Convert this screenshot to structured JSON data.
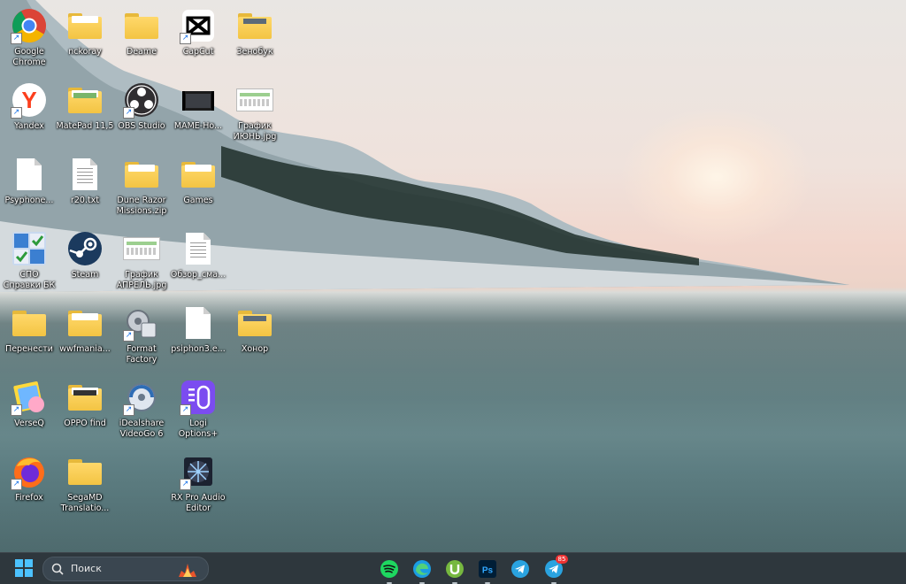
{
  "desktop": {
    "icons": [
      {
        "label": "Google Chrome",
        "icon": "chrome-icon"
      },
      {
        "label": "nckoray",
        "icon": "folder-icon"
      },
      {
        "label": "Deame",
        "icon": "folder-icon"
      },
      {
        "label": "CapCut",
        "icon": "capcut-icon"
      },
      {
        "label": "Зенобук",
        "icon": "folder-icon"
      },
      {
        "label": "Yandex",
        "icon": "yandex-icon"
      },
      {
        "label": "MatePad 11,5",
        "icon": "folder-icon"
      },
      {
        "label": "OBS Studio",
        "icon": "obs-icon"
      },
      {
        "label": "MAME-Ho...",
        "icon": "video-thumb-icon"
      },
      {
        "label": "График ИЮНЬ.jpg",
        "icon": "image-file-icon"
      },
      {
        "label": "Psyphone...",
        "icon": "blank-file-icon"
      },
      {
        "label": "r20.txt",
        "icon": "text-file-icon"
      },
      {
        "label": "Dune Razor Missions.zip",
        "icon": "zip-folder-icon"
      },
      {
        "label": "Games",
        "icon": "folder-icon"
      },
      {
        "label": "СПО Справки БК",
        "icon": "spo-app-icon"
      },
      {
        "label": "Steam",
        "icon": "steam-icon"
      },
      {
        "label": "График АПРЕЛЬ.jpg",
        "icon": "image-file-icon"
      },
      {
        "label": "Обзор_сма...",
        "icon": "text-file-icon"
      },
      {
        "label": "Перенести",
        "icon": "folder-icon"
      },
      {
        "label": "wwfmania...",
        "icon": "zip-folder-icon"
      },
      {
        "label": "Format Factory",
        "icon": "format-factory-icon"
      },
      {
        "label": "psiphon3.e...",
        "icon": "blank-file-icon"
      },
      {
        "label": "Хонор",
        "icon": "folder-icon"
      },
      {
        "label": "VerseQ",
        "icon": "verseq-icon"
      },
      {
        "label": "OPPO find",
        "icon": "folder-icon"
      },
      {
        "label": "iDealshare VideoGo 6",
        "icon": "videogo-icon"
      },
      {
        "label": "Logi Options+",
        "icon": "logi-icon"
      },
      {
        "label": "Firefox",
        "icon": "firefox-icon"
      },
      {
        "label": "SegaMD Translatio...",
        "icon": "folder-icon"
      },
      {
        "label": "RX Pro Audio Editor",
        "icon": "rx-audio-icon"
      }
    ]
  },
  "taskbar": {
    "search_placeholder": "Поиск",
    "apps": [
      {
        "icon": "spotify-icon",
        "color": "#1ed760"
      },
      {
        "icon": "edge-icon",
        "color": "#1b9de2"
      },
      {
        "icon": "utorrent-icon",
        "color": "#76b83f"
      },
      {
        "icon": "photoshop-icon",
        "color": "#31a8ff"
      },
      {
        "icon": "telegram-icon",
        "color": "#2aa3e0"
      },
      {
        "icon": "telegram-badge-icon",
        "color": "#2aa3e0",
        "badge": "85"
      }
    ]
  }
}
